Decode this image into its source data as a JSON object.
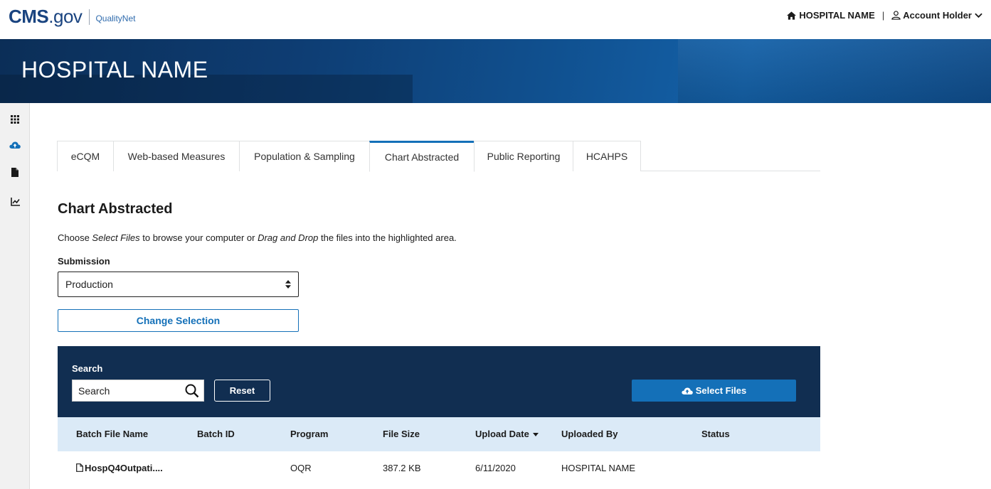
{
  "header": {
    "logo_cms": "CMS",
    "logo_gov": ".gov",
    "logo_product": "QualityNet",
    "hospital_link": "HOSPITAL NAME",
    "separator": "|",
    "account": "Account Holder",
    "icons": [
      "home-icon",
      "user-icon",
      "chevron-down-icon"
    ]
  },
  "banner": {
    "title": "HOSPITAL NAME"
  },
  "sidebar": {
    "items": [
      {
        "icon": "grid-icon"
      },
      {
        "icon": "cloud-upload-icon"
      },
      {
        "icon": "document-icon"
      },
      {
        "icon": "chart-line-icon"
      }
    ]
  },
  "tabs": [
    {
      "label": "eCQM",
      "active": false
    },
    {
      "label": "Web-based Measures",
      "active": false
    },
    {
      "label": "Population & Sampling",
      "active": false
    },
    {
      "label": "Chart Abstracted",
      "active": true
    },
    {
      "label": "Public Reporting",
      "active": false
    },
    {
      "label": "HCAHPS",
      "active": false
    }
  ],
  "main": {
    "title": "Chart Abstracted",
    "instructions": {
      "p1": "Choose ",
      "em1": "Select Files",
      "p2": " to browse your computer or ",
      "em2": "Drag and Drop",
      "p3": " the files into the highlighted area."
    },
    "submission_label": "Submission",
    "submission_value": "Production",
    "change_selection": "Change Selection"
  },
  "panel": {
    "search_label": "Search",
    "search_placeholder": "Search",
    "reset": "Reset",
    "select_files": "Select Files"
  },
  "table": {
    "columns": [
      "Batch File Name",
      "Batch ID",
      "Program",
      "File Size",
      "Upload Date",
      "Uploaded By",
      "Status"
    ],
    "sorted_column": "Upload Date",
    "rows": [
      {
        "name": "HospQ4Outpati....",
        "batch_id": "",
        "program": "OQR",
        "size": "387.2 KB",
        "date": "6/11/2020",
        "uploaded_by": "HOSPITAL NAME",
        "status": ""
      }
    ]
  },
  "colors": {
    "brand_blue": "#1470b8",
    "panel_navy": "#112e51",
    "header_row": "#dbeaf7"
  }
}
